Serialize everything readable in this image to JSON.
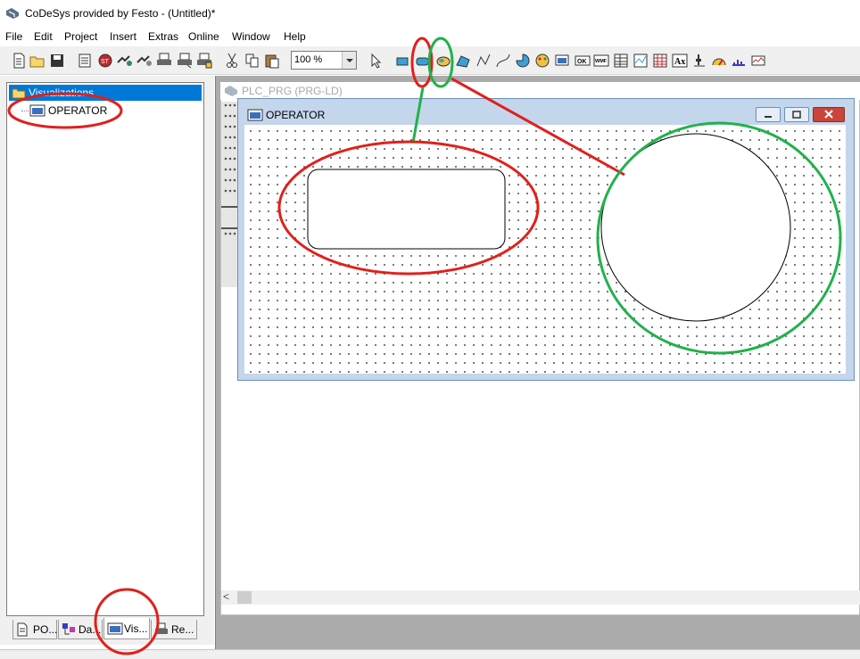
{
  "app": {
    "title": "CoDeSys provided by Festo - (Untitled)*"
  },
  "menu": [
    "File",
    "Edit",
    "Project",
    "Insert",
    "Extras",
    "Online",
    "Window",
    "Help"
  ],
  "toolbar": {
    "zoom": "100 %",
    "icons": [
      "new-icon",
      "open-icon",
      "save-icon",
      "build-icon",
      "stop-icon",
      "login-icon",
      "logout-icon",
      "print-icon",
      "print2-icon",
      "print3-icon",
      "cut-icon",
      "copy-icon",
      "paste-icon",
      "select-icon",
      "rectangle-icon",
      "rounded-rectangle-icon",
      "ellipse-icon",
      "polygon-icon",
      "polyline-icon",
      "curve-icon",
      "pie-icon",
      "bitmap-icon",
      "visualization-icon",
      "button-icon",
      "wmf-icon",
      "table-icon",
      "trend-icon",
      "alarm-table-icon",
      "activex-icon",
      "scrollbar-icon",
      "meter-icon",
      "bar-display-icon",
      "histogram-icon"
    ],
    "ok_label": "OK",
    "wmf_label": "WMF"
  },
  "tree": {
    "root": "Visualizations",
    "child": "OPERATOR"
  },
  "tabs": [
    {
      "label": "PO..."
    },
    {
      "label": "Da..."
    },
    {
      "label": "Vis..."
    },
    {
      "label": "Re..."
    }
  ],
  "plc_window": {
    "title": "PLC_PRG (PRG-LD)"
  },
  "operator_window": {
    "title": "OPERATOR"
  },
  "colors": {
    "annotation_red": "#e0201c",
    "annotation_green": "#22b14c",
    "selection_blue": "#0078d7"
  }
}
